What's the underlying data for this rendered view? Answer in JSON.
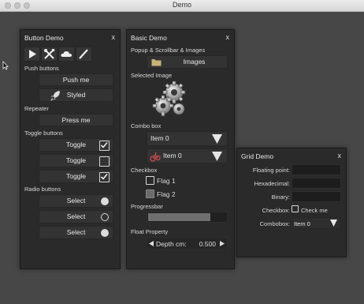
{
  "app": {
    "title": "Demo"
  },
  "button_demo": {
    "title": "Button Demo",
    "close": "x",
    "toolbar_icons": [
      "play-icon",
      "tools-icon",
      "cloud-icon",
      "pen-icon"
    ],
    "push_section": "Push buttons",
    "push_me": "Push me",
    "styled": "Styled",
    "repeater_section": "Repeater",
    "press_me": "Press me",
    "toggle_section": "Toggle buttons",
    "toggles": [
      {
        "label": "Toggle",
        "checked": true
      },
      {
        "label": "Toggle",
        "checked": false
      },
      {
        "label": "Toggle",
        "checked": true
      }
    ],
    "radio_section": "Radio buttons",
    "radios": [
      {
        "label": "Select",
        "selected": true
      },
      {
        "label": "Select",
        "selected": false
      },
      {
        "label": "Select",
        "selected": true
      }
    ]
  },
  "basic_demo": {
    "title": "Basic Demo",
    "close": "x",
    "popup_section": "Popup & Scrollbar & Images",
    "images_button": "Images",
    "selected_image_section": "Selected Image",
    "combo_section": "Combo box",
    "combo1_value": "Item 0",
    "combo2_value": "Item 0",
    "checkbox_section": "Checkbox",
    "flag1": {
      "label": "Flag 1",
      "checked": false
    },
    "flag2": {
      "label": "Flag 2",
      "checked": true
    },
    "progress_section": "Progressbar",
    "progress_fraction": 0.78,
    "float_section": "Float Property",
    "float_label": "Depth cm:",
    "float_value": "0.500"
  },
  "grid_demo": {
    "title": "Grid Demo",
    "close": "x",
    "labels": {
      "floating": "Floating point:",
      "hex": "Hexadecimal:",
      "binary": "Binary:",
      "checkbox": "Checkbox:",
      "combobox": "Combobox:"
    },
    "check_me": "Check me",
    "combo_value": "Item 0"
  },
  "colors": {
    "accent": "#c94b4b",
    "panel": "#2a2a2a",
    "background": "#474747"
  }
}
